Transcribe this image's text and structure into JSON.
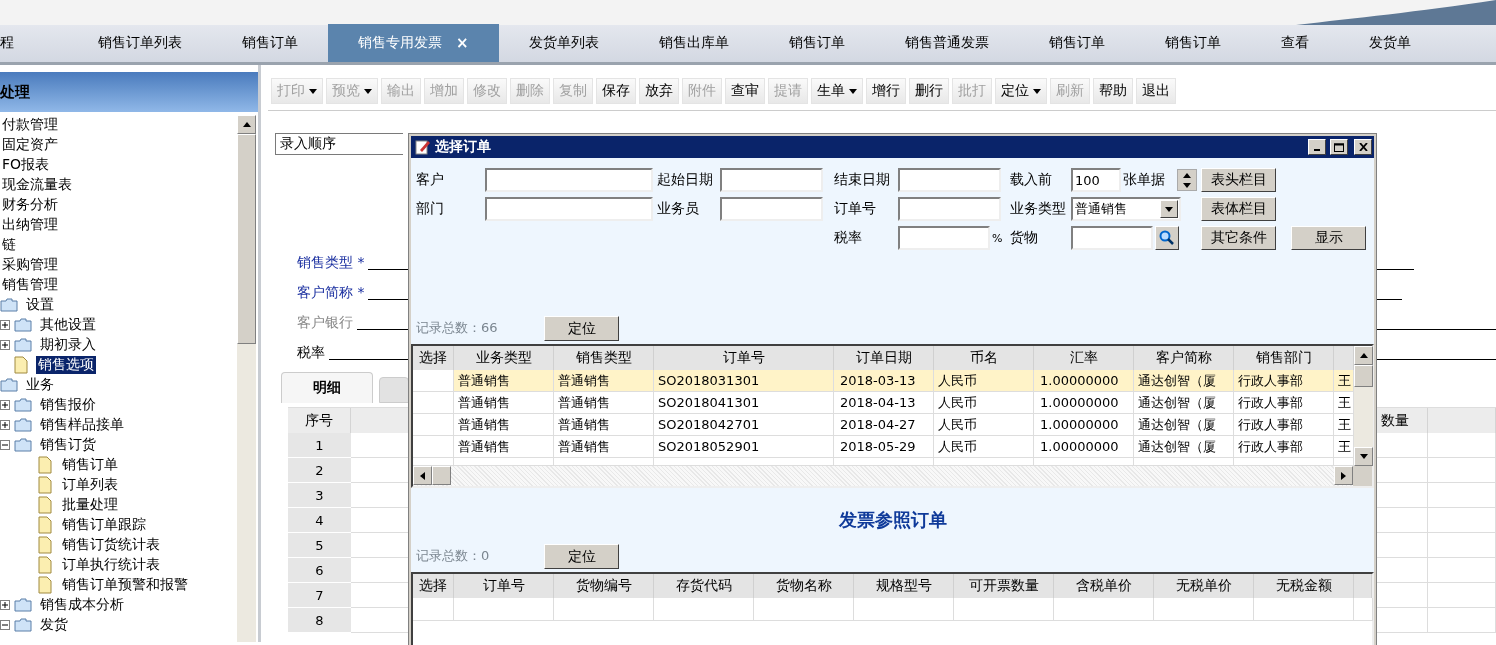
{
  "tabs": [
    {
      "label": "程",
      "selected": false
    },
    {
      "label": "销售订单列表",
      "selected": false
    },
    {
      "label": "销售订单",
      "selected": false
    },
    {
      "label": "销售专用发票",
      "selected": true,
      "close": "×"
    },
    {
      "label": "发货单列表",
      "selected": false
    },
    {
      "label": "销售出库单",
      "selected": false
    },
    {
      "label": "销售订单",
      "selected": false
    },
    {
      "label": "销售普通发票",
      "selected": false
    },
    {
      "label": "销售订单",
      "selected": false
    },
    {
      "label": "销售订单",
      "selected": false
    },
    {
      "label": "查看",
      "selected": false
    },
    {
      "label": "发货单",
      "selected": false
    }
  ],
  "sidebar": {
    "title": "处理",
    "tree": [
      {
        "label": "付款管理",
        "selected": false
      },
      {
        "label": "固定资产",
        "selected": false
      },
      {
        "label": "FO报表",
        "selected": false
      },
      {
        "label": "现金流量表",
        "selected": false
      },
      {
        "label": "财务分析",
        "selected": false
      },
      {
        "label": "出纳管理",
        "selected": false
      },
      {
        "label": "链",
        "selected": false
      },
      {
        "label": "采购管理",
        "selected": false
      },
      {
        "label": "销售管理",
        "selected": false,
        "children": [
          {
            "label": "设置",
            "kind": "folder",
            "selected": false,
            "children": [
              {
                "label": "其他设置",
                "kind": "folder",
                "selected": false,
                "expanded": false
              },
              {
                "label": "期初录入",
                "kind": "folder",
                "selected": false,
                "expanded": false
              },
              {
                "label": "销售选项",
                "kind": "doc",
                "selected": true
              }
            ]
          },
          {
            "label": "业务",
            "kind": "folder",
            "selected": false,
            "children": [
              {
                "label": "销售报价",
                "kind": "folder",
                "selected": false,
                "expanded": false
              },
              {
                "label": "销售样品接单",
                "kind": "folder",
                "selected": false,
                "expanded": false
              },
              {
                "label": "销售订货",
                "kind": "folder",
                "selected": false,
                "expanded": true,
                "children": [
                  {
                    "label": "销售订单",
                    "kind": "doc",
                    "selected": false
                  },
                  {
                    "label": "订单列表",
                    "kind": "doc",
                    "selected": false
                  },
                  {
                    "label": "批量处理",
                    "kind": "doc",
                    "selected": false
                  },
                  {
                    "label": "销售订单跟踪",
                    "kind": "doc",
                    "selected": false
                  },
                  {
                    "label": "销售订货统计表",
                    "kind": "doc",
                    "selected": false
                  },
                  {
                    "label": "订单执行统计表",
                    "kind": "doc",
                    "selected": false
                  },
                  {
                    "label": "销售订单预警和报警",
                    "kind": "doc",
                    "selected": false
                  }
                ]
              },
              {
                "label": "销售成本分析",
                "kind": "folder",
                "selected": false,
                "expanded": false
              },
              {
                "label": "发货",
                "kind": "folder",
                "selected": false,
                "expanded": true
              }
            ]
          }
        ]
      }
    ]
  },
  "toolbar": [
    {
      "label": "打印",
      "kind": "dropdown",
      "disabled": true
    },
    {
      "label": "预览",
      "kind": "dropdown",
      "disabled": true
    },
    {
      "label": "输出",
      "kind": "plain",
      "disabled": true
    },
    {
      "label": "增加",
      "kind": "plain",
      "disabled": true
    },
    {
      "label": "修改",
      "kind": "plain",
      "disabled": true
    },
    {
      "label": "删除",
      "kind": "plain",
      "disabled": true
    },
    {
      "label": "复制",
      "kind": "plain",
      "disabled": true
    },
    {
      "label": "保存",
      "kind": "plain",
      "disabled": false
    },
    {
      "label": "放弃",
      "kind": "plain",
      "disabled": false
    },
    {
      "label": "附件",
      "kind": "plain",
      "disabled": true
    },
    {
      "label": "查审",
      "kind": "plain",
      "disabled": false
    },
    {
      "label": "提请",
      "kind": "plain",
      "disabled": true
    },
    {
      "label": "生单",
      "kind": "dropdown",
      "disabled": false
    },
    {
      "label": "增行",
      "kind": "plain",
      "disabled": false
    },
    {
      "label": "删行",
      "kind": "plain",
      "disabled": false
    },
    {
      "label": "批打",
      "kind": "plain",
      "disabled": true
    },
    {
      "label": "定位",
      "kind": "dropdown",
      "disabled": false
    },
    {
      "label": "刷新",
      "kind": "plain",
      "disabled": true
    },
    {
      "label": "帮助",
      "kind": "plain",
      "disabled": false
    },
    {
      "label": "退出",
      "kind": "plain",
      "disabled": false
    }
  ],
  "form": {
    "sort_order": "录入顺序",
    "fields": [
      {
        "label": "销售类型 *",
        "required": true,
        "disabled": false
      },
      {
        "label": "客户简称 *",
        "required": true,
        "disabled": false
      },
      {
        "label": "客户银行",
        "required": false,
        "disabled": true
      },
      {
        "label": "税率",
        "required": false,
        "disabled": false
      }
    ],
    "detail_tab": {
      "label": "明细",
      "selected": true
    },
    "grid": {
      "columns": [
        "序号",
        "数量"
      ],
      "rows": [
        "1",
        "2",
        "3",
        "4",
        "5",
        "6",
        "7",
        "8"
      ]
    }
  },
  "dialog": {
    "title": "选择订单",
    "filter_rows": [
      [
        {
          "label": "客户",
          "kind": "text"
        },
        {
          "label": "起始日期",
          "kind": "text"
        },
        {
          "label": "结束日期",
          "kind": "text"
        },
        {
          "label": "载入前",
          "kind": "count",
          "value": "100",
          "suffix": "张单据"
        }
      ],
      [
        {
          "label": "部门",
          "kind": "text"
        },
        {
          "label": "业务员",
          "kind": "text"
        },
        {
          "label": "订单号",
          "kind": "text"
        },
        {
          "label": "业务类型",
          "kind": "select",
          "value": "普通销售"
        }
      ],
      [
        {
          "label": "税率",
          "kind": "percent",
          "suffix": "%"
        },
        {
          "label": "货物",
          "kind": "lookup"
        }
      ]
    ],
    "buttons": [
      "表头栏目",
      "表体栏目",
      "其它条件",
      "显示"
    ],
    "orders": {
      "count": "记录总数：66",
      "locate": "定位",
      "columns": [
        "选择",
        "业务类型",
        "销售类型",
        "订单号",
        "订单日期",
        "币名",
        "汇率",
        "客户简称",
        "销售部门"
      ],
      "rows": [
        {
          "selected": true,
          "cells": [
            "",
            "普通销售",
            "普通销售",
            "SO2018031301",
            "2018-03-13",
            "人民币",
            "1.00000000",
            "通达创智（厦",
            "行政人事部",
            "王"
          ]
        },
        {
          "selected": false,
          "cells": [
            "",
            "普通销售",
            "普通销售",
            "SO2018041301",
            "2018-04-13",
            "人民币",
            "1.00000000",
            "通达创智（厦",
            "行政人事部",
            "王"
          ]
        },
        {
          "selected": false,
          "cells": [
            "",
            "普通销售",
            "普通销售",
            "SO2018042701",
            "2018-04-27",
            "人民币",
            "1.00000000",
            "通达创智（厦",
            "行政人事部",
            "王"
          ]
        },
        {
          "selected": false,
          "cells": [
            "",
            "普通销售",
            "普通销售",
            "SO2018052901",
            "2018-05-29",
            "人民币",
            "1.00000000",
            "通达创智（厦",
            "行政人事部",
            "王"
          ]
        }
      ]
    },
    "reference": {
      "title": "发票参照订单",
      "count": "记录总数：0",
      "locate": "定位",
      "columns": [
        "选择",
        "订单号",
        "货物编号",
        "存货代码",
        "货物名称",
        "规格型号",
        "可开票数量",
        "含税单价",
        "无税单价",
        "无税金额"
      ]
    }
  }
}
